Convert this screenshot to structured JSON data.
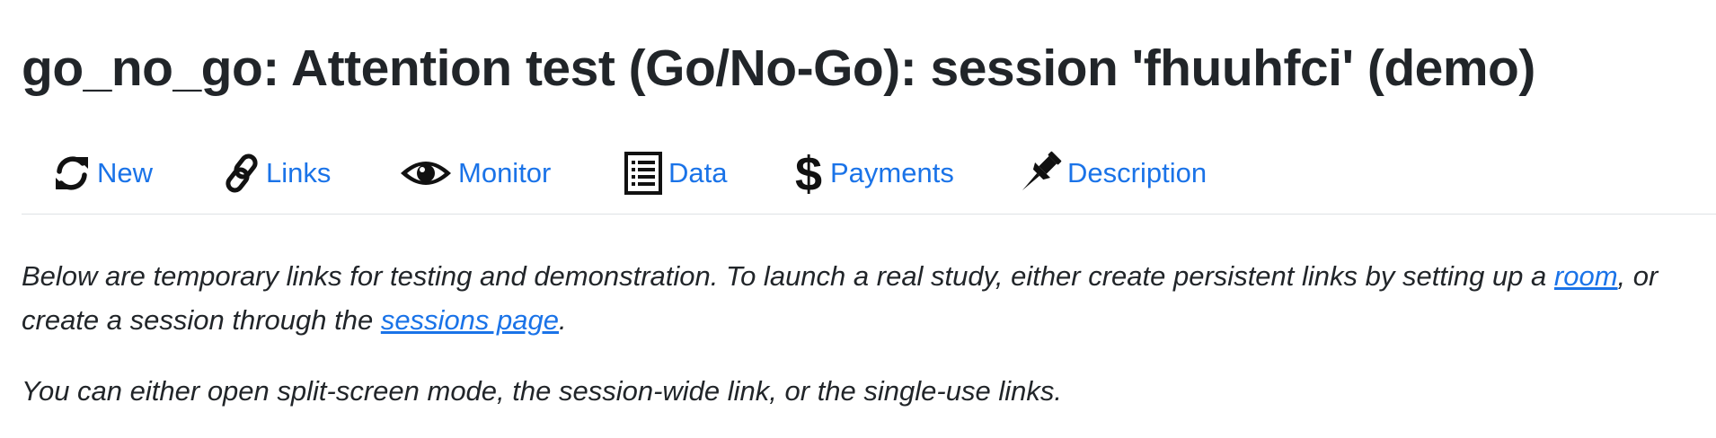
{
  "title": "go_no_go: Attention test (Go/No-Go): session 'fhuuhfci' (demo)",
  "nav": {
    "items": [
      {
        "icon": "refresh-icon",
        "label": "New"
      },
      {
        "icon": "link-icon",
        "label": "Links"
      },
      {
        "icon": "eye-icon",
        "label": "Monitor"
      },
      {
        "icon": "list-document-icon",
        "label": "Data"
      },
      {
        "icon": "dollar-icon",
        "label": "Payments"
      },
      {
        "icon": "pushpin-icon",
        "label": "Description"
      }
    ]
  },
  "content": {
    "intro_part1": "Below are temporary links for testing and demonstration. To launch a real study, either create persistent links by setting up a ",
    "room_link": "room",
    "intro_part2": ", or create a session through the ",
    "sessions_link": "sessions page",
    "intro_part3": ".",
    "options_text": "You can either open split-screen mode, the session-wide link, or the single-use links."
  },
  "colors": {
    "link": "#1a73e8",
    "text": "#212529",
    "divider": "#dee2e6"
  }
}
